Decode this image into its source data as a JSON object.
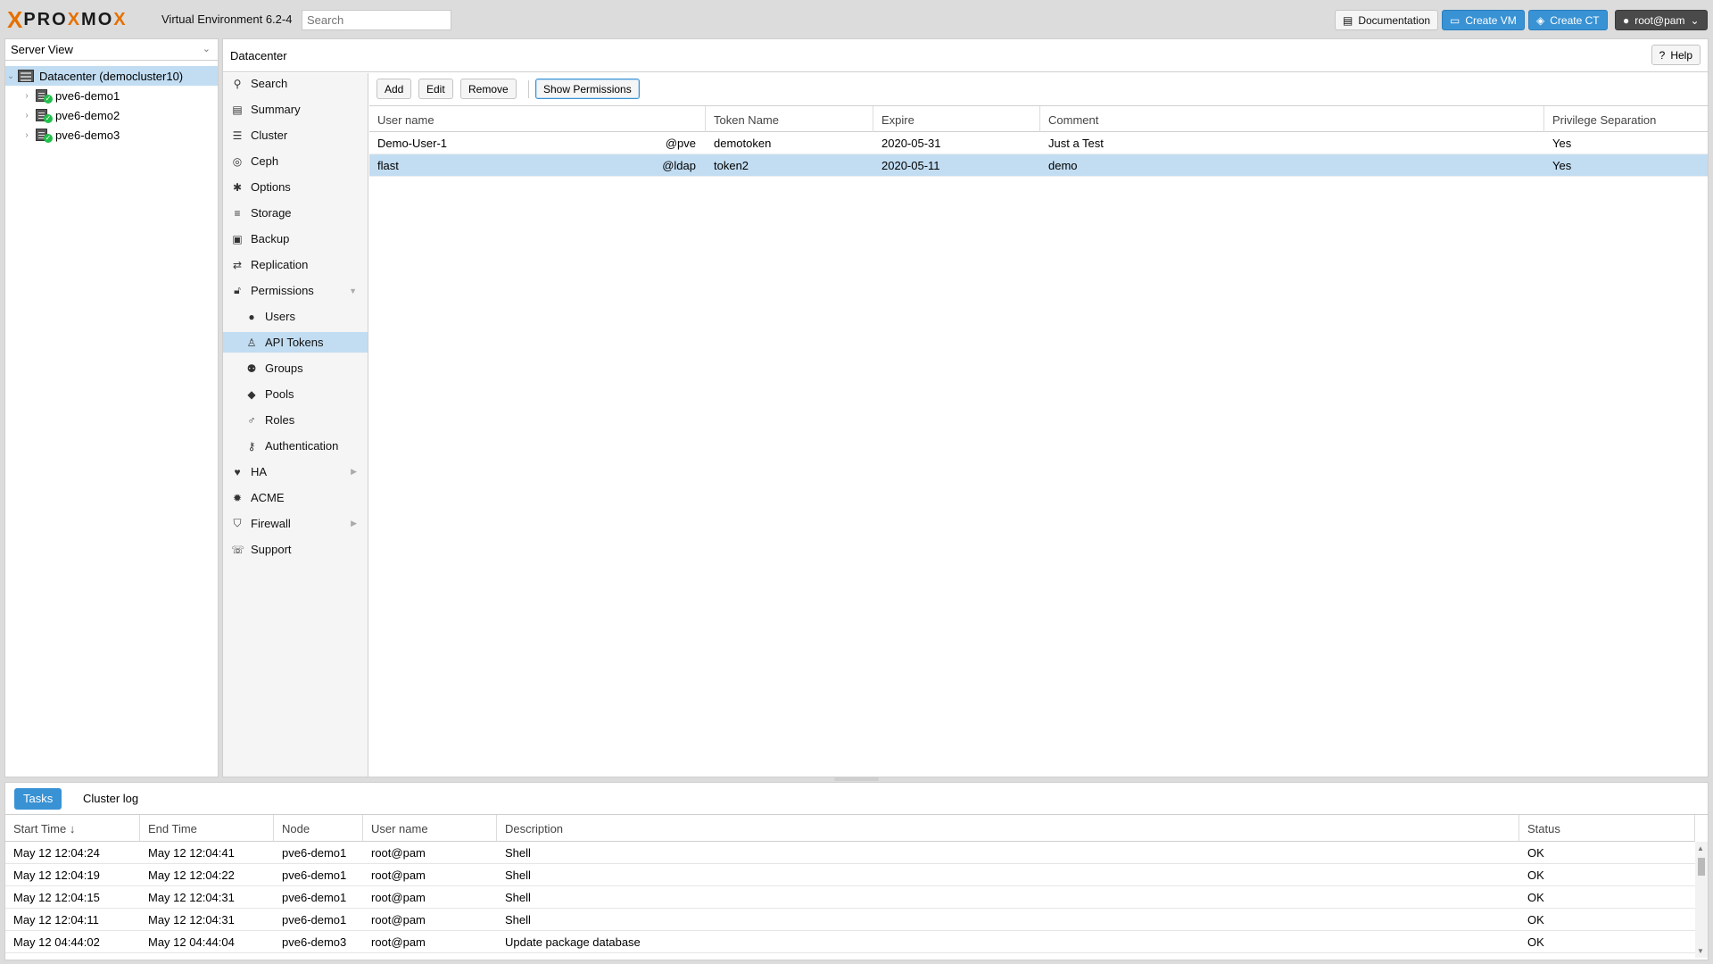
{
  "header": {
    "logo_x": "X",
    "logo_pro": "PRO",
    "logo_x2": "X",
    "logo_mo": "MO",
    "logo_x3": "X",
    "version": "Virtual Environment 6.2-4",
    "search_placeholder": "Search",
    "documentation_label": "Documentation",
    "create_vm_label": "Create VM",
    "create_ct_label": "Create CT",
    "user_label": "root@pam",
    "brand_color": "#e57000",
    "accent_color": "#3892d4"
  },
  "tree": {
    "view_label": "Server View",
    "datacenter": "Datacenter (democluster10)",
    "nodes": [
      "pve6-demo1",
      "pve6-demo2",
      "pve6-demo3"
    ]
  },
  "content": {
    "title": "Datacenter",
    "help_label": "Help"
  },
  "nav": [
    {
      "label": "Search",
      "icon": "search-icon"
    },
    {
      "label": "Summary",
      "icon": "book-icon"
    },
    {
      "label": "Cluster",
      "icon": "server-icon"
    },
    {
      "label": "Ceph",
      "icon": "ceph-icon"
    },
    {
      "label": "Options",
      "icon": "gear-icon"
    },
    {
      "label": "Storage",
      "icon": "database-icon"
    },
    {
      "label": "Backup",
      "icon": "floppy-icon"
    },
    {
      "label": "Replication",
      "icon": "retweet-icon"
    },
    {
      "label": "Permissions",
      "icon": "unlock-icon"
    },
    {
      "label": "Users",
      "icon": "user-icon"
    },
    {
      "label": "API Tokens",
      "icon": "token-icon"
    },
    {
      "label": "Groups",
      "icon": "users-icon"
    },
    {
      "label": "Pools",
      "icon": "tags-icon"
    },
    {
      "label": "Roles",
      "icon": "male-icon"
    },
    {
      "label": "Authentication",
      "icon": "key-icon"
    },
    {
      "label": "HA",
      "icon": "heartbeat-icon"
    },
    {
      "label": "ACME",
      "icon": "certificate-icon"
    },
    {
      "label": "Firewall",
      "icon": "shield-icon"
    },
    {
      "label": "Support",
      "icon": "comments-icon"
    }
  ],
  "toolbar": {
    "add_label": "Add",
    "edit_label": "Edit",
    "remove_label": "Remove",
    "show_permissions_label": "Show Permissions"
  },
  "tokens": {
    "columns": [
      "User name",
      "Token Name",
      "Expire",
      "Comment",
      "Privilege Separation"
    ],
    "rows": [
      {
        "user": "Demo-User-1",
        "realm": "@pve",
        "token": "demotoken",
        "expire": "2020-05-31",
        "comment": "Just a Test",
        "privsep": "Yes"
      },
      {
        "user": "flast",
        "realm": "@ldap",
        "token": "token2",
        "expire": "2020-05-11",
        "comment": "demo",
        "privsep": "Yes"
      }
    ]
  },
  "log": {
    "tabs": [
      "Tasks",
      "Cluster log"
    ],
    "columns": [
      "Start Time ↓",
      "End Time",
      "Node",
      "User name",
      "Description",
      "Status"
    ],
    "rows": [
      {
        "start": "May 12 12:04:24",
        "end": "May 12 12:04:41",
        "node": "pve6-demo1",
        "user": "root@pam",
        "desc": "Shell",
        "status": "OK"
      },
      {
        "start": "May 12 12:04:19",
        "end": "May 12 12:04:22",
        "node": "pve6-demo1",
        "user": "root@pam",
        "desc": "Shell",
        "status": "OK"
      },
      {
        "start": "May 12 12:04:15",
        "end": "May 12 12:04:31",
        "node": "pve6-demo1",
        "user": "root@pam",
        "desc": "Shell",
        "status": "OK"
      },
      {
        "start": "May 12 12:04:11",
        "end": "May 12 12:04:31",
        "node": "pve6-demo1",
        "user": "root@pam",
        "desc": "Shell",
        "status": "OK"
      },
      {
        "start": "May 12 04:44:02",
        "end": "May 12 04:44:04",
        "node": "pve6-demo3",
        "user": "root@pam",
        "desc": "Update package database",
        "status": "OK"
      }
    ]
  }
}
